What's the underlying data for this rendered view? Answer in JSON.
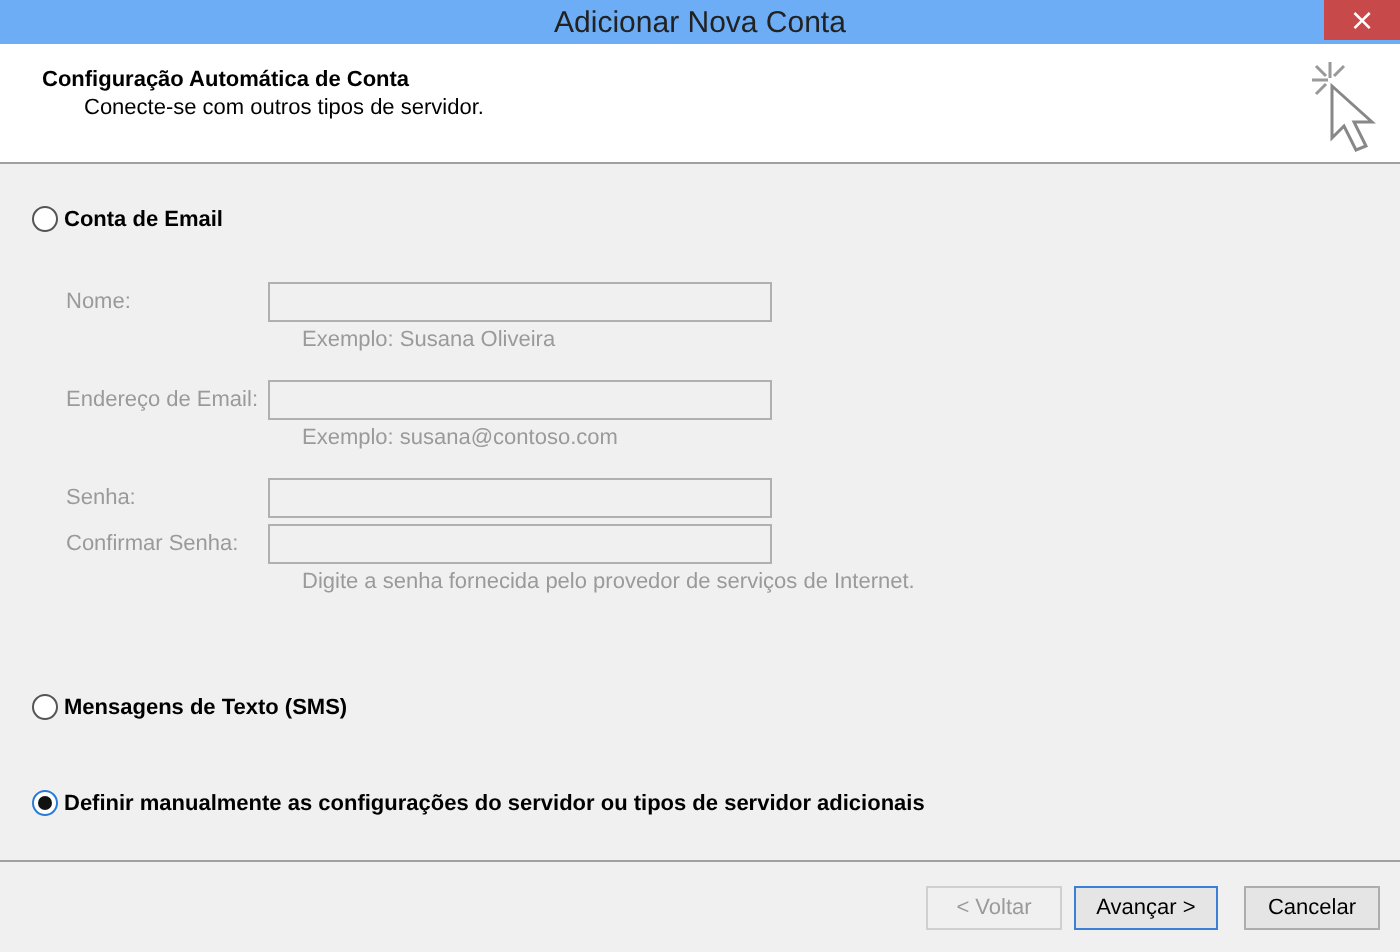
{
  "window": {
    "title": "Adicionar Nova Conta",
    "close": "×"
  },
  "header": {
    "title": "Configuração Automática de Conta",
    "subtitle": "Conecte-se com outros tipos de servidor."
  },
  "options": [
    {
      "label": "Conta de Email",
      "selected": false,
      "fields": [
        {
          "label": "Nome:",
          "disabled": true,
          "hint": "Exemplo: Susana Oliveira"
        },
        {
          "label": "Endereço de Email:",
          "disabled": true,
          "hint": "Exemplo: susana@contoso.com"
        },
        {
          "label": "Senha:",
          "disabled": true
        },
        {
          "label": "Confirmar Senha:",
          "disabled": true,
          "hint": "Digite a senha fornecida pelo provedor de serviços de Internet."
        }
      ]
    },
    {
      "label": "Mensagens de Texto (SMS)",
      "selected": false
    },
    {
      "label": "Definir manualmente as configurações do servidor ou tipos de servidor adicionais",
      "selected": true
    }
  ],
  "buttons": [
    {
      "label": "< Voltar",
      "disabled": true,
      "default": false
    },
    {
      "label": "Avançar >",
      "disabled": false,
      "default": true
    },
    {
      "label": "Cancelar",
      "disabled": false,
      "default": false
    }
  ]
}
